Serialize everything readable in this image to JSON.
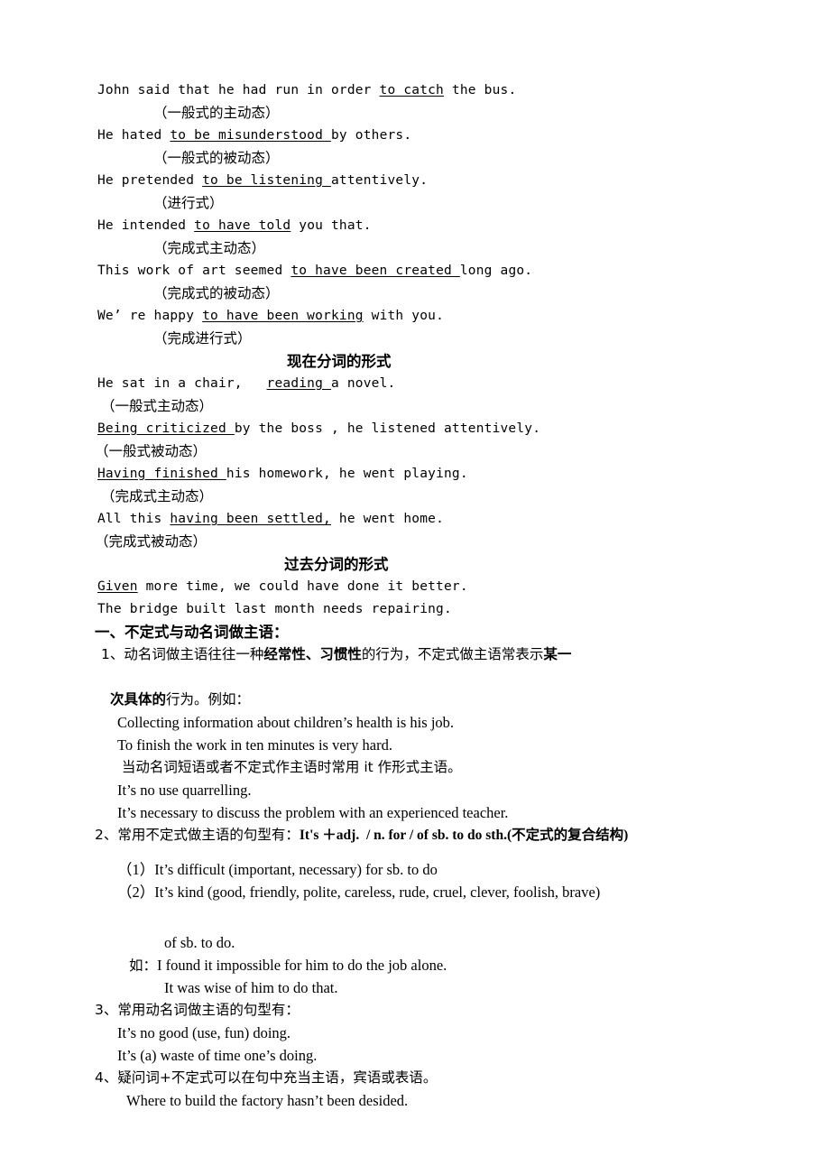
{
  "document": {
    "background": "#ffffff",
    "text_color": "#000000",
    "sections": {
      "infinitive_examples": [
        {
          "english": "John said that he had run in order ",
          "underlined": "to catch",
          "english_tail": " the bus.",
          "note": "（一般式的主动态）"
        },
        {
          "english": "He hated ",
          "underlined": "to be misunderstood ",
          "english_tail": "by others.",
          "note": "（一般式的被动态）"
        },
        {
          "english": "He pretended ",
          "underlined": "to be listening ",
          "english_tail": "attentively.",
          "note": "（进行式）"
        },
        {
          "english": "He intended ",
          "underlined": "to have told",
          "english_tail": " you that.",
          "note": "（完成式主动态）"
        },
        {
          "english": "This work of art seemed ",
          "underlined": "to have been created ",
          "english_tail": "long ago.",
          "note": "（完成式的被动态）"
        },
        {
          "english": "We’ re happy ",
          "underlined": "to have been working",
          "english_tail": " with you.",
          "note": "（完成进行式）"
        }
      ],
      "present_participle": {
        "heading": "现在分词的形式",
        "examples": [
          {
            "english": "He sat in a chair,   ",
            "underlined": "reading ",
            "english_tail": "a novel.",
            "note": "（一般式主动态）"
          },
          {
            "english": "",
            "underlined": "Being criticized ",
            "english_tail": "by the boss , he listened attentively.",
            "note": "（一般式被动态）"
          },
          {
            "english": "",
            "underlined": "Having finished ",
            "english_tail": "his homework, he went playing.",
            "note": "（完成式主动态）"
          },
          {
            "english": "All this ",
            "underlined": "having been settled,",
            "english_tail": " he went home.",
            "note": "（完成式被动态）"
          }
        ]
      },
      "past_participle": {
        "heading": "过去分词的形式",
        "examples": [
          {
            "english": "",
            "underlined": "Given",
            "english_tail": " more time, we could have done it better."
          },
          {
            "english": "The bridge built last month needs repairing.",
            "underlined": "",
            "english_tail": ""
          }
        ]
      },
      "part_one": {
        "heading": "一、不定式与动名词做主语：",
        "item1": {
          "prefix": "1、动名词做主语往往一种",
          "bold1": "经常性、习惯性",
          "middle": "的行为，不定式做主语常表示",
          "bold2": "某一",
          "cont_bold": "次具体的",
          "cont_tail": "行为。例如："
        },
        "item1_examples": [
          "Collecting information about children’s health is his job.",
          "To finish the work in ten minutes is very hard."
        ],
        "item1_note": " 当动名词短语或者不定式作主语时常用 it 作形式主语。",
        "item1_examples2": [
          "It’s no use quarrelling.",
          "It’s necessary to discuss the problem with an experienced teacher."
        ],
        "item2": {
          "prefix": "2、常用不定式做主语的句型有：",
          "bold": "It's ＋adj.  / n. for / of sb. to do sth.(不定式的复合结构)"
        },
        "item2_subitems": [
          "（1）It’s difficult (important, necessary) for sb. to do",
          "（2）It’s kind (good, friendly, polite, careless, rude, cruel, clever, foolish, brave)"
        ],
        "item2_cont": "of sb. to do.",
        "item2_eg_label": "如：",
        "item2_eg": "I found it impossible for him to do the job alone.",
        "item2_eg2": "It was wise of him to do that.",
        "item3": {
          "heading": "3、常用动名词做主语的句型有：",
          "examples": [
            "It’s no good (use, fun) doing.",
            "It’s (a) waste of time one’s doing."
          ]
        },
        "item4": {
          "heading": "4、疑问词+不定式可以在句中充当主语，宾语或表语。",
          "examples": [
            "Where to build the factory hasn’t been desided."
          ]
        }
      }
    }
  }
}
